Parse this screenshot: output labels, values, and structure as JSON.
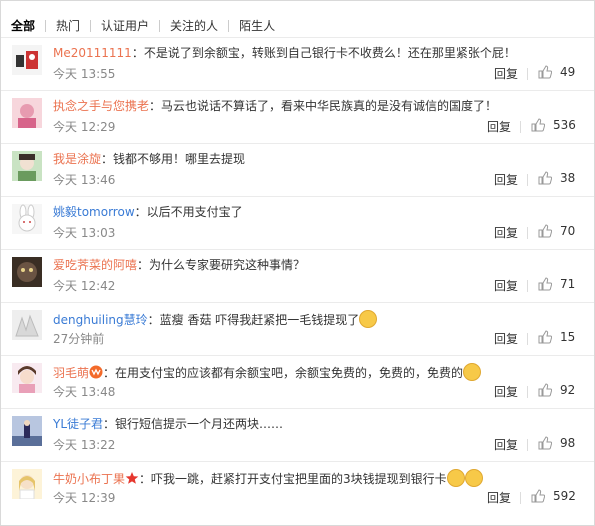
{
  "tabs": [
    "全部",
    "热门",
    "认证用户",
    "关注的人",
    "陌生人"
  ],
  "comments": [
    {
      "user": "Me20111111",
      "text": "：不是说了到余额宝，转账到自己银行卡不收费么！还在那里紧张个屁！",
      "time": "今天 13:55",
      "reply": "回复",
      "likes": "49"
    },
    {
      "user": "执念之手与您携老",
      "text": "：马云也说话不算话了，看来中华民族真的是没有诚信的国度了！",
      "time": "今天 12:29",
      "reply": "回复",
      "likes": "536"
    },
    {
      "user": "我是涂旋",
      "text": "：钱都不够用！哪里去提现",
      "time": "今天 13:46",
      "reply": "回复",
      "likes": "38"
    },
    {
      "user": "姚毅tomorrow",
      "text": "：以后不用支付宝了",
      "time": "今天 13:03",
      "reply": "回复",
      "likes": "70"
    },
    {
      "user": "爱吃荠菜的阿嘻",
      "text": "：为什么专家要研究这种事情？",
      "time": "今天 12:42",
      "reply": "回复",
      "likes": "71"
    },
    {
      "user": "denghuiling慧玲",
      "text": "：蓝瘦 香菇  吓得我赶紧把一毛钱提现了",
      "time": "27分钟前",
      "reply": "回复",
      "likes": "15"
    },
    {
      "user": "羽毛萌",
      "text": "：在用支付宝的应该都有余额宝吧，余额宝免费的，免费的，免费的",
      "time": "今天 13:48",
      "reply": "回复",
      "likes": "92"
    },
    {
      "user": "YL徒子君",
      "text": "：银行短信提示一个月还两块……",
      "time": "今天 13:22",
      "reply": "回复",
      "likes": "98"
    },
    {
      "user": "牛奶小布丁果",
      "text": "：吓我一跳，赶紧打开支付宝把里面的3块钱提现到银行卡",
      "time": "今天 12:39",
      "reply": "回复",
      "likes": "592"
    }
  ],
  "colors": {
    "username": "#eb7350",
    "username_blue": "#3a7bd5",
    "time": "#888888"
  },
  "icons": {
    "like": "thumbs-up-icon",
    "emoji": "smiley-emoji-icon"
  }
}
